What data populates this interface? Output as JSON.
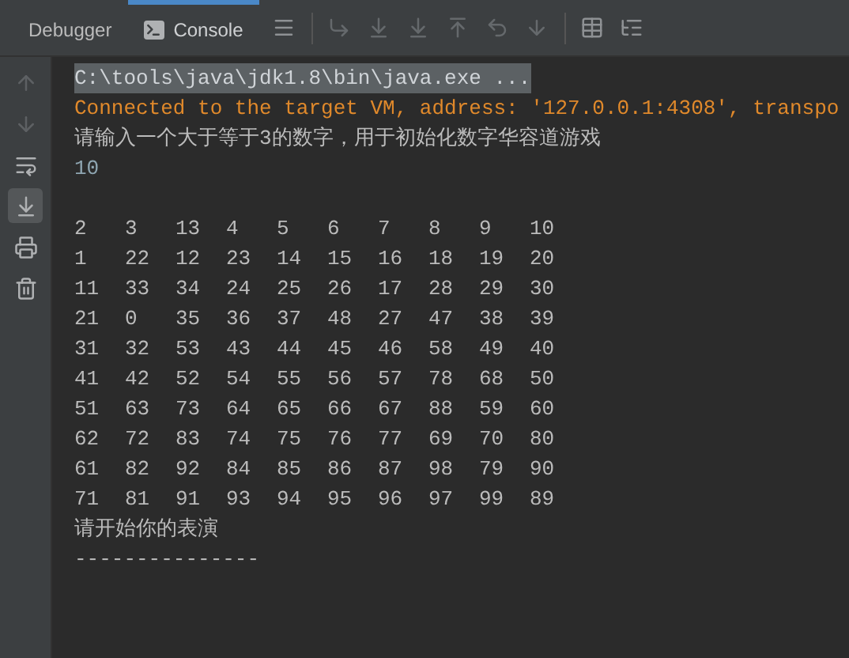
{
  "tabs": [
    {
      "label": "Debugger",
      "selected": false,
      "icon": false
    },
    {
      "label": "Console",
      "selected": true,
      "icon": true
    }
  ],
  "toolbar": [
    {
      "kind": "menu",
      "disabled": false
    },
    {
      "kind": "step_over",
      "disabled": true
    },
    {
      "kind": "step_into",
      "disabled": true
    },
    {
      "kind": "force_step_into",
      "disabled": true
    },
    {
      "kind": "step_out",
      "disabled": true
    },
    {
      "kind": "drop_frame",
      "disabled": true
    },
    {
      "kind": "run_to_cursor",
      "disabled": true
    },
    {
      "kind": "evaluate",
      "disabled": false
    },
    {
      "kind": "trace",
      "disabled": false
    }
  ],
  "gutter": [
    {
      "kind": "up",
      "disabled": true,
      "on": false
    },
    {
      "kind": "down",
      "disabled": true,
      "on": false
    },
    {
      "kind": "wrap",
      "disabled": false,
      "on": false
    },
    {
      "kind": "scroll_end",
      "disabled": false,
      "on": true
    },
    {
      "kind": "print",
      "disabled": false,
      "on": false
    },
    {
      "kind": "clear",
      "disabled": false,
      "on": false
    }
  ],
  "console": [
    {
      "kind": "command",
      "text": "C:\\tools\\java\\jdk1.8\\bin\\java.exe ..."
    },
    {
      "kind": "system",
      "text": "Connected to the target VM, address: '127.0.0.1:4308', transpo"
    },
    {
      "kind": "output",
      "text": "请输入一个大于等于3的数字，用于初始化数字华容道游戏"
    },
    {
      "kind": "input",
      "text": "10"
    },
    {
      "kind": "grid",
      "rows": [
        [
          "2",
          "3",
          "13",
          "4",
          "5",
          "6",
          "7",
          "8",
          "9",
          "10"
        ],
        [
          "1",
          "22",
          "12",
          "23",
          "14",
          "15",
          "16",
          "18",
          "19",
          "20"
        ],
        [
          "11",
          "33",
          "34",
          "24",
          "25",
          "26",
          "17",
          "28",
          "29",
          "30"
        ],
        [
          "21",
          "0",
          "35",
          "36",
          "37",
          "48",
          "27",
          "47",
          "38",
          "39"
        ],
        [
          "31",
          "32",
          "53",
          "43",
          "44",
          "45",
          "46",
          "58",
          "49",
          "40"
        ],
        [
          "41",
          "42",
          "52",
          "54",
          "55",
          "56",
          "57",
          "78",
          "68",
          "50"
        ],
        [
          "51",
          "63",
          "73",
          "64",
          "65",
          "66",
          "67",
          "88",
          "59",
          "60"
        ],
        [
          "62",
          "72",
          "83",
          "74",
          "75",
          "76",
          "77",
          "69",
          "70",
          "80"
        ],
        [
          "61",
          "82",
          "92",
          "84",
          "85",
          "86",
          "87",
          "98",
          "79",
          "90"
        ],
        [
          "71",
          "81",
          "91",
          "93",
          "94",
          "95",
          "96",
          "97",
          "99",
          "89"
        ]
      ]
    },
    {
      "kind": "output",
      "text": "请开始你的表演"
    },
    {
      "kind": "output",
      "text": "---------------"
    }
  ]
}
